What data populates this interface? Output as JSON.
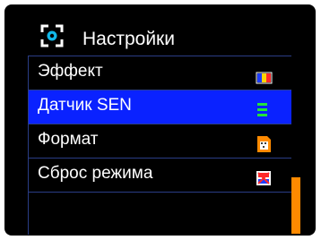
{
  "header": {
    "title": "Настройки",
    "icon": "settings-frame-icon"
  },
  "menu": {
    "items": [
      {
        "label": "Эффект",
        "icon": "color-effect-icon"
      },
      {
        "label": "Датчик SEN",
        "icon": "sensor-bars-icon",
        "selected": true
      },
      {
        "label": "Формат",
        "icon": "format-card-icon"
      },
      {
        "label": "Сброс режима",
        "icon": "reset-mode-icon"
      }
    ]
  },
  "scrollbar": {
    "position_fraction": 1.0
  },
  "colors": {
    "background": "#000000",
    "selection": "#0a22ff",
    "scroll_thumb": "#ff8a00",
    "divider": "#2a3d86",
    "text": "#ffffff"
  }
}
